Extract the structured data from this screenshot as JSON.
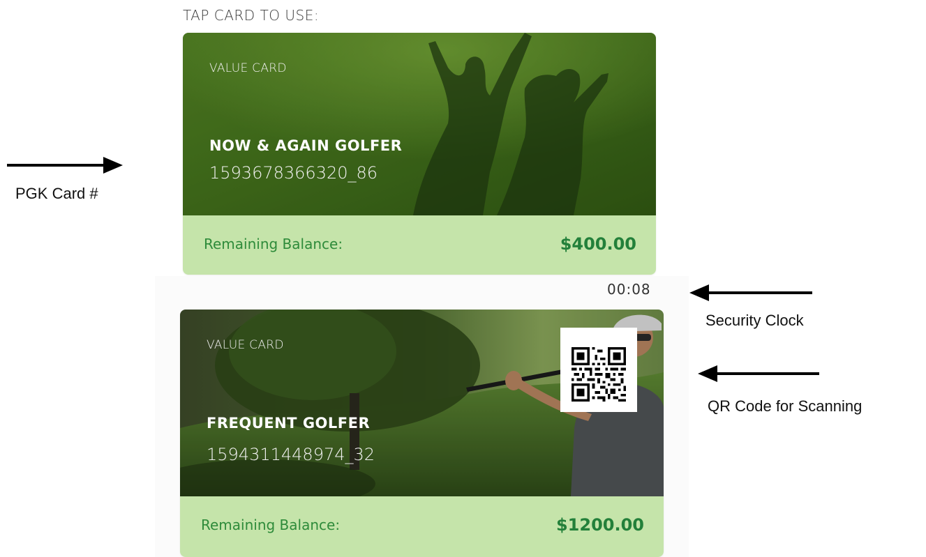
{
  "header": {
    "title": "TAP CARD TO USE:"
  },
  "cards": [
    {
      "type_label": "VALUE CARD",
      "name": "NOW & AGAIN GOLFER",
      "number": "1593678366320_86",
      "balance_label": "Remaining Balance:",
      "balance_value": "$400.00"
    },
    {
      "type_label": "VALUE CARD",
      "name": "FREQUENT GOLFER",
      "number": "1594311448974_32",
      "balance_label": "Remaining Balance:",
      "balance_value": "$1200.00"
    }
  ],
  "security_clock": "00:08",
  "annotations": {
    "card_number": "PGK Card #",
    "security_clock": "Security Clock",
    "qr_code": "QR Code for Scanning"
  },
  "colors": {
    "footer_bg": "#c5e4aa",
    "balance_text": "#23803a"
  }
}
